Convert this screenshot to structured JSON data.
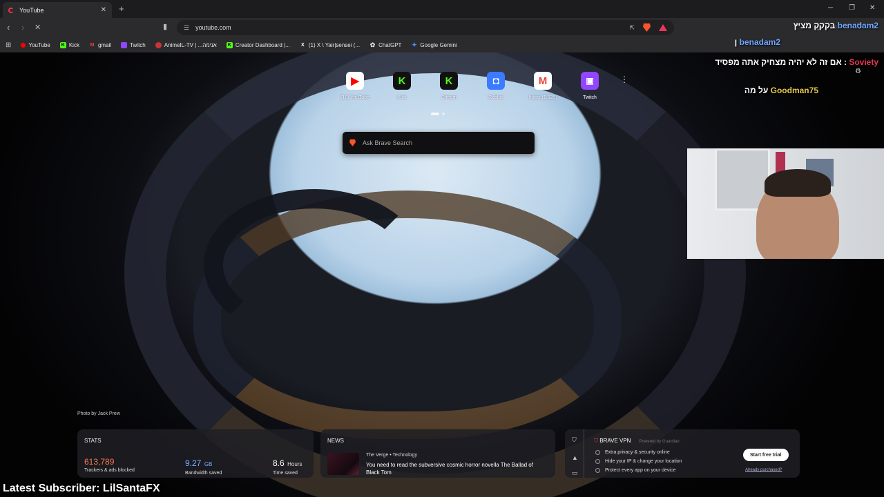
{
  "browser": {
    "tab_title": "YouTube",
    "new_tab": "+",
    "url": "youtube.com",
    "bookmarks": [
      {
        "label": "YouTube",
        "icon": "youtube-icon",
        "color": "#ff0000"
      },
      {
        "label": "Kick",
        "icon": "kick-icon",
        "color": "#53fc18"
      },
      {
        "label": "gmail",
        "icon": "gmail-icon",
        "color": "#ea4335"
      },
      {
        "label": "Twitch",
        "icon": "twitch-icon",
        "color": "#9146ff"
      },
      {
        "label": "AnimeIL-TV | ...אנימה",
        "icon": "animeil-icon",
        "color": "#c33"
      },
      {
        "label": "Creator Dashboard |...",
        "icon": "kick-icon",
        "color": "#53fc18"
      },
      {
        "label": "(1) X \\ Yair|sensei (...",
        "icon": "x-icon",
        "color": "#ffffff"
      },
      {
        "label": "ChatGPT",
        "icon": "chatgpt-icon",
        "color": "#dddddd"
      },
      {
        "label": "Google Gemini",
        "icon": "gemini-icon",
        "color": "#4b90ff"
      }
    ]
  },
  "topsites": [
    {
      "label": "(18) YouTube",
      "icon": "youtube-icon",
      "color": "#ff0000",
      "glyph": "▶"
    },
    {
      "label": "Kick",
      "icon": "kick-icon",
      "color": "#53fc18",
      "glyph": "K"
    },
    {
      "label": "Stream",
      "icon": "kick-icon",
      "color": "#53fc18",
      "glyph": "K"
    },
    {
      "label": "Roblox",
      "icon": "roblox-icon",
      "color": "#3a7bff",
      "glyph": "◘"
    },
    {
      "label": "Inbox (1,625)",
      "icon": "gmail-icon",
      "color": "#ea4335",
      "glyph": "M"
    },
    {
      "label": "Twitch",
      "icon": "twitch-icon",
      "color": "#9146ff",
      "glyph": "▣"
    }
  ],
  "search": {
    "placeholder": "Ask Brave Search"
  },
  "photo_credit": "Photo by Jack Prew",
  "stats": {
    "title": "STATS",
    "trackers": {
      "value": "613,789",
      "desc": "Trackers & ads blocked"
    },
    "bandwidth": {
      "value": "9.27",
      "unit": "GB",
      "desc": "Bandwidth saved"
    },
    "time": {
      "value": "8.6",
      "unit": "Hours",
      "desc": "Time saved"
    }
  },
  "news": {
    "title": "NEWS",
    "source": "The Verge",
    "category": "Technology",
    "headline": "You need to read the subversive cosmic horror novella The Ballad of Black Tom"
  },
  "vpn": {
    "title": "BRAVE VPN",
    "powered": "Powered by Guardian",
    "features": [
      "Extra privacy & security online",
      "Hide your IP & change your location",
      "Protect every app on your device"
    ],
    "cta": "Start free trial",
    "purchased": "Already purchased?"
  },
  "stream_chat": [
    {
      "user": "benadam2",
      "message": "בקקק מציץ",
      "user_color": "#6ea6ff"
    },
    {
      "user": "benadam2",
      "message": "ן",
      "user_color": "#6ea6ff"
    },
    {
      "user": "Soviety",
      "message": "אם זה לא יהיה מצחיק אתה מפסיד",
      "user_color": "#e8384f"
    },
    {
      "user": "Goodman75",
      "message": "על מה",
      "user_color": "#e6c84a"
    }
  ],
  "overlay": {
    "latest_subscriber": "Latest Subscriber: LilSantaFX"
  }
}
